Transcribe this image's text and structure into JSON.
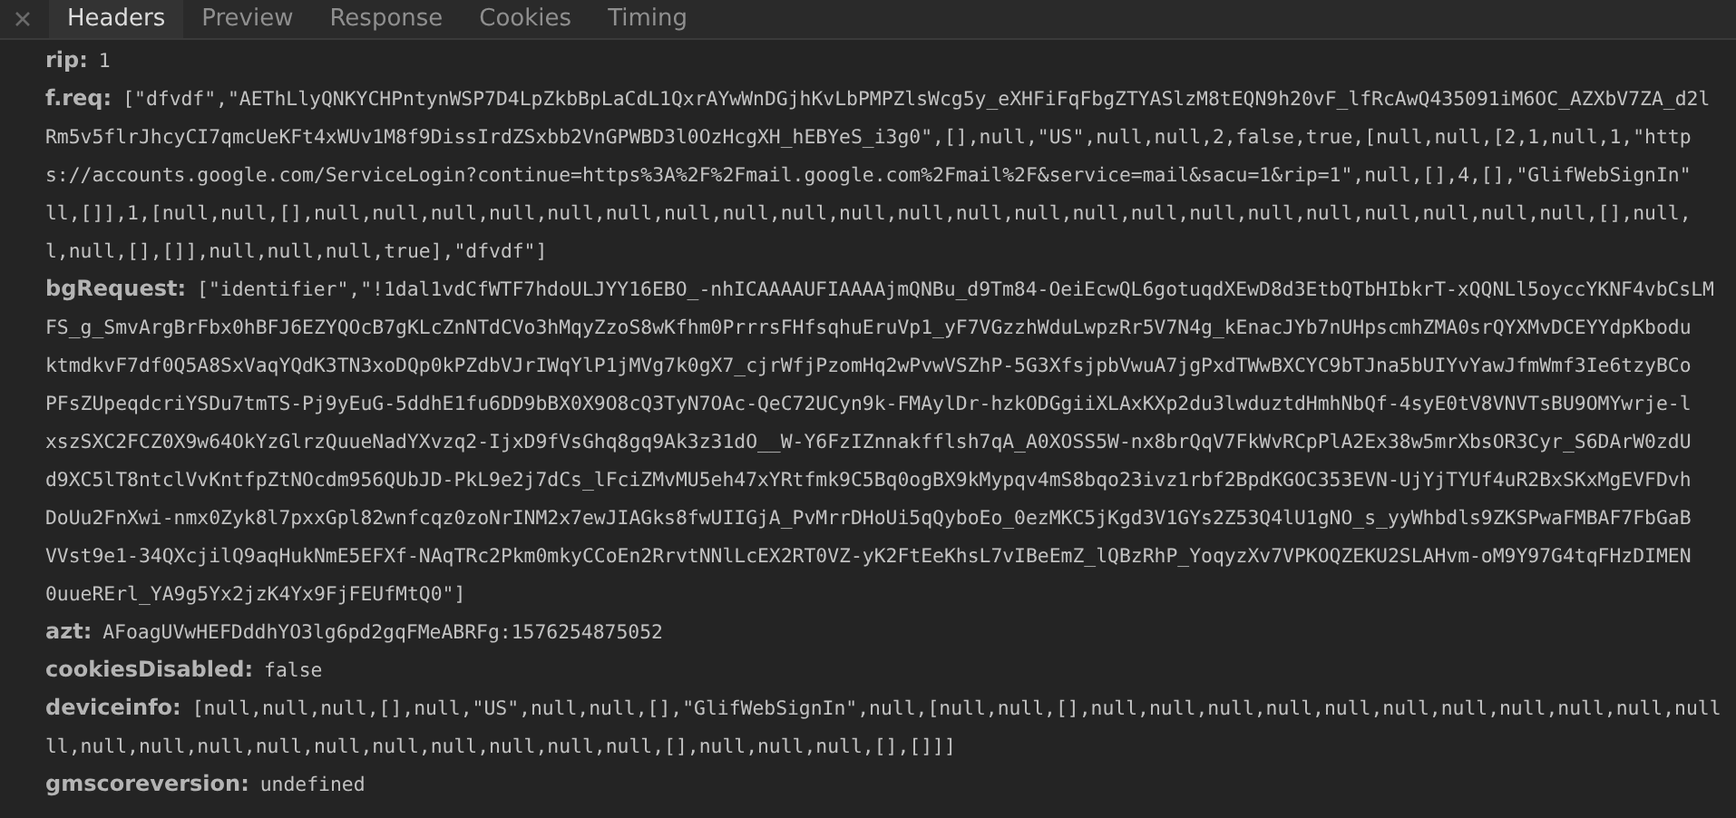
{
  "tabs": [
    {
      "label": "Headers",
      "selected": true
    },
    {
      "label": "Preview",
      "selected": false
    },
    {
      "label": "Response",
      "selected": false
    },
    {
      "label": "Cookies",
      "selected": false
    },
    {
      "label": "Timing",
      "selected": false
    }
  ],
  "params": [
    {
      "name": "rip:",
      "lines": [
        "1"
      ]
    },
    {
      "name": "f.req:",
      "lines": [
        "[\"dfvdf\",\"AEThLlyQNKYCHPntynWSP7D4LpZkbBpLaCdL1QxrAYwWnDGjhKvLbPMPZlsWcg5y_eXHFiFqFbgZTYASlzM8tEQN9h20vF_lfRcAwQ435091iM6OC_AZXbV7ZA_d2l",
        "Rm5v5flrJhcyCI7qmcUeKFt4xWUv1M8f9DissIrdZSxbb2VnGPWBD3l0OzHcgXH_hEBYeS_i3g0\",[],null,\"US\",null,null,2,false,true,[null,null,[2,1,null,1,\"http",
        "s://accounts.google.com/ServiceLogin?continue=https%3A%2F%2Fmail.google.com%2Fmail%2F&service=mail&sacu=1&rip=1\",null,[],4,[],\"GlifWebSignIn\"",
        "ll,[]],1,[null,null,[],null,null,null,null,null,null,null,null,null,null,null,null,null,null,null,null,null,null,null,null,null,null,[],null,",
        "l,null,[],[]],null,null,null,true],\"dfvdf\"]"
      ]
    },
    {
      "name": "bgRequest:",
      "lines": [
        "[\"identifier\",\"!1dal1vdCfWTF7hdoULJYY16EBO_-nhICAAAAUFIAAAAjmQNBu_d9Tm84-OeiEcwQL6gotuqdXEwD8d3EtbQTbHIbkrT-xQQNLl5oyccYKNF4vbCsLM",
        "FS_g_SmvArgBrFbx0hBFJ6EZYQOcB7gKLcZnNTdCVo3hMqyZzoS8wKfhm0PrrrsFHfsqhuEruVp1_yF7VGzzhWduLwpzRr5V7N4g_kEnacJYb7nUHpscmhZMA0srQYXMvDCEYYdpKbodu",
        "ktmdkvF7df0Q5A8SxVaqYQdK3TN3xoDQp0kPZdbVJrIWqYlP1jMVg7k0gX7_cjrWfjPzomHq2wPvwVSZhP-5G3XfsjpbVwuA7jgPxdTWwBXCYC9bTJna5bUIYvYawJfmWmf3Ie6tzyBCo",
        "PFsZUpeqdcriYSDu7tmTS-Pj9yEuG-5ddhE1fu6DD9bBX0X9O8cQ3TyN7OAc-QeC72UCyn9k-FMAylDr-hzkODGgiiXLAxKXp2du3lwduztdHmhNbQf-4syE0tV8VNVTsBU9OMYwrje-l",
        "xszSXC2FCZ0X9w64OkYzGlrzQuueNadYXvzq2-IjxD9fVsGhq8gq9Ak3z31dO__W-Y6FzIZnnakfflsh7qA_A0XOSS5W-nx8brQqV7FkWvRCpPlA2Ex38w5mrXbsOR3Cyr_S6DArW0zdU",
        "d9XC5lT8ntclVvKntfpZtNOcdm956QUbJD-PkL9e2j7dCs_lFciZMvMU5eh47xYRtfmk9C5Bq0ogBX9kMypqv4mS8bqo23ivz1rbf2BpdKGOC353EVN-UjYjTYUf4uR2BxSKxMgEVFDvh",
        "DoUu2FnXwi-nmx0Zyk8l7pxxGpl82wnfcqz0zoNrINM2x7ewJIAGks8fwUIIGjA_PvMrrDHoUi5qQyboEo_0ezMKC5jKgd3V1GYs2Z53Q4lU1gNO_s_yyWhbdls9ZKSPwaFMBAF7FbGaB",
        "VVst9e1-34QXcjilQ9aqHukNmE5EFXf-NAqTRc2Pkm0mkyCCoEn2RrvtNNlLcEX2RT0VZ-yK2FtEeKhsL7vIBeEmZ_lQBzRhP_YoqyzXv7VPKOQZEKU2SLAHvm-oM9Y97G4tqFHzDIMEN",
        "0uueRErl_YA9g5Yx2jzK4Yx9FjFEUfMtQ0\"]"
      ]
    },
    {
      "name": "azt:",
      "lines": [
        "AFoagUVwHEFDddhYO3lg6pd2gqFMeABRFg:1576254875052"
      ]
    },
    {
      "name": "cookiesDisabled:",
      "lines": [
        "false"
      ]
    },
    {
      "name": "deviceinfo:",
      "lines": [
        "[null,null,null,[],null,\"US\",null,null,[],\"GlifWebSignIn\",null,[null,null,[],null,null,null,null,null,null,null,null,null,null,null",
        "ll,null,null,null,null,null,null,null,null,null,null,[],null,null,null,[],[]]]"
      ]
    },
    {
      "name": "gmscoreversion:",
      "lines": [
        "undefined"
      ]
    }
  ]
}
